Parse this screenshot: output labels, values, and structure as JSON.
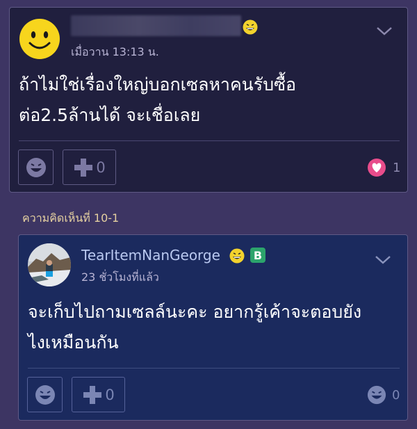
{
  "comment1": {
    "time": "เมื่อวาน  13:13 น.",
    "text_line1": "ถ้าไม่ใช่เรื่องใหญ่บอกเซลหาคนรับซื้อ",
    "text_line2": "ต่อ2.5ล้านได้ จะเชื่อเลย",
    "plus_count": "0",
    "heart_count": "1"
  },
  "section_label": "ความคิดเห็นที่ 10-1",
  "comment2": {
    "username": "TearItemNanGeorge",
    "badge": "B",
    "time": "23 ชั่วโมงที่แล้ว",
    "text_line1": "จะเก็บไปถามเซลล์นะคะ อยากรู้เค้าจะตอบยัง",
    "text_line2": "ไงเหมือนกัน",
    "plus_count": "0",
    "vote_count": "0"
  },
  "colors": {
    "page_bg": "#3d3563",
    "card1_bg": "#201f3e",
    "card2_bg": "#1b2a5e",
    "section_label": "#e6d1a1",
    "heart": "#e84c8b"
  },
  "icons": [
    "smiley-avatar",
    "grin-emoji",
    "chevron-down-icon",
    "smiley-reaction-icon",
    "plus-icon",
    "heart-icon"
  ]
}
